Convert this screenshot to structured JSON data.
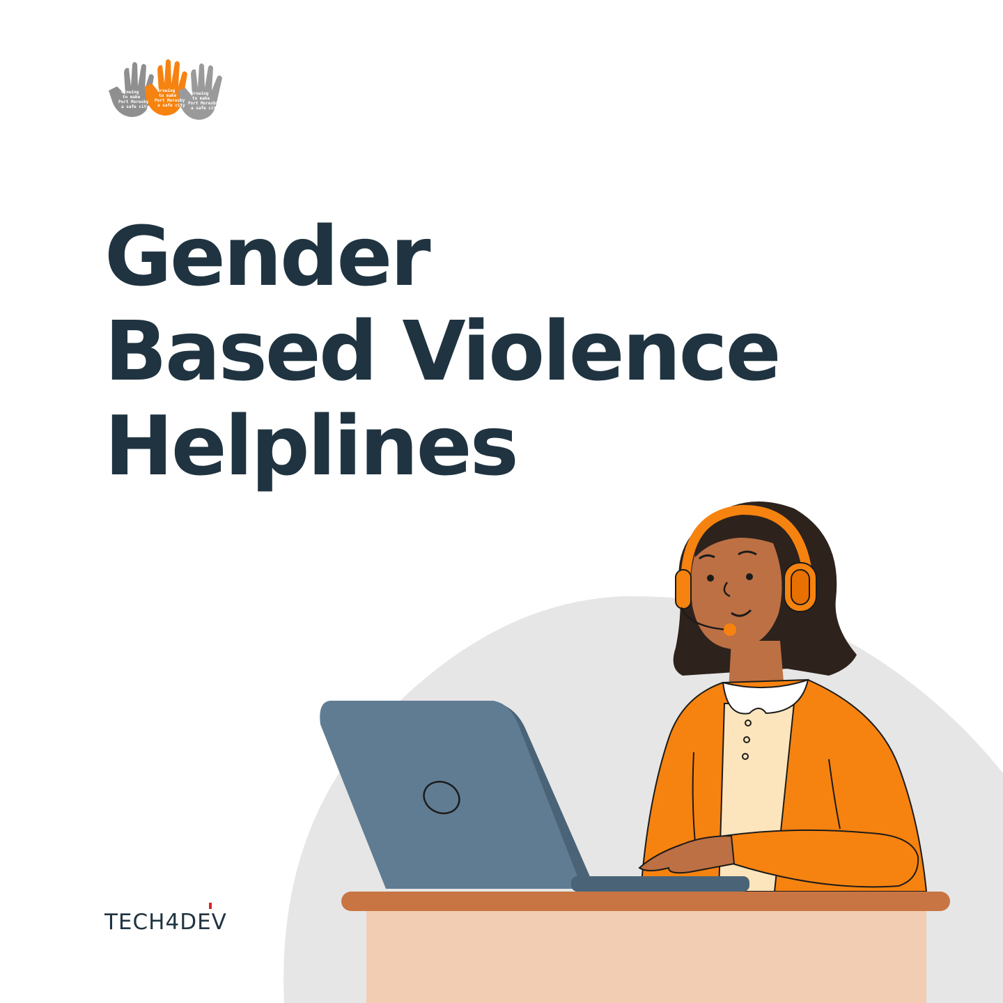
{
  "headline": {
    "line1": "Gender",
    "line2": "Based Violence",
    "line3": "Helplines"
  },
  "brand": {
    "name": "TECH4DEV"
  },
  "logo": {
    "hand_text_lines": [
      "Growing",
      "to make",
      "Port Moresby",
      "a safe city"
    ]
  },
  "colors": {
    "headline": "#1f3340",
    "accent_orange": "#f6820f",
    "laptop": "#5f7c92",
    "desk_top": "#c97443",
    "desk_front": "#f3cdb3",
    "backdrop": "#e6e6e6",
    "hair": "#2e221c",
    "skin": "#bd7044",
    "blouse": "#fce5bd"
  },
  "icons": [
    "hands-logo-icon",
    "operator-illustration",
    "laptop-icon",
    "headset-icon"
  ]
}
